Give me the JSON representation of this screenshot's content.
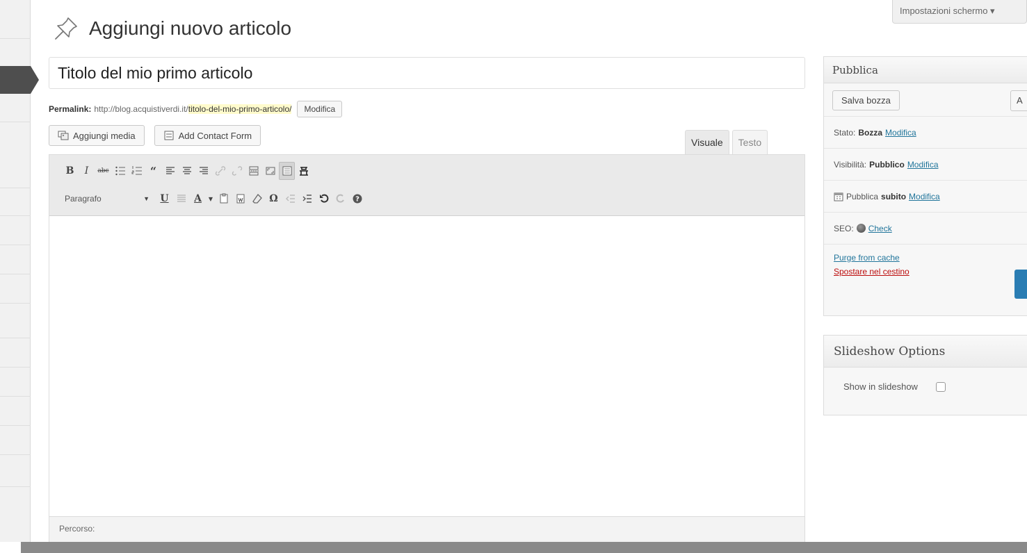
{
  "screen_options": {
    "label": "Impostazioni schermo ▾"
  },
  "header": {
    "title": "Aggiungi nuovo articolo"
  },
  "post": {
    "title": "Titolo del mio primo articolo"
  },
  "permalink": {
    "label": "Permalink:",
    "base": "http://blog.acquistiverdi.it/",
    "slug": "titolo-del-mio-primo-articolo/",
    "edit_label": "Modifica"
  },
  "media_buttons": {
    "add_media": "Aggiungi media",
    "add_contact_form": "Add Contact Form"
  },
  "editor_tabs": {
    "visual": "Visuale",
    "text": "Testo"
  },
  "toolbar": {
    "format_value": "Paragrafo",
    "row1_icons": [
      "bold-icon",
      "italic-icon",
      "strikethrough-icon",
      "bullet-list-icon",
      "numbered-list-icon",
      "blockquote-icon",
      "align-left-icon",
      "align-center-icon",
      "align-right-icon",
      "insert-link-icon",
      "unlink-icon",
      "insert-more-icon",
      "fullscreen-icon",
      "kitchen-sink-icon",
      "contact-form-icon"
    ],
    "row2_icons": [
      "underline-icon",
      "justify-icon",
      "text-color-icon",
      "paste-text-icon",
      "paste-word-icon",
      "clear-formatting-icon",
      "special-char-icon",
      "outdent-icon",
      "indent-icon",
      "undo-icon",
      "redo-icon",
      "help-icon"
    ]
  },
  "editor": {
    "path_label": "Percorso:"
  },
  "publish_box": {
    "title": "Pubblica",
    "save_draft": "Salva bozza",
    "preview": "A",
    "status_label": "Stato:",
    "status_value": "Bozza",
    "visibility_label": "Visibilità:",
    "visibility_value": "Pubblico",
    "publish_label": "Pubblica",
    "publish_value": "subito",
    "edit_label": "Modifica",
    "seo_label": "SEO:",
    "seo_check": "Check",
    "purge_cache": "Purge from cache",
    "move_to_trash": "Spostare nel cestino"
  },
  "slideshow_box": {
    "title": "Slideshow Options",
    "show_label": "Show in slideshow"
  }
}
